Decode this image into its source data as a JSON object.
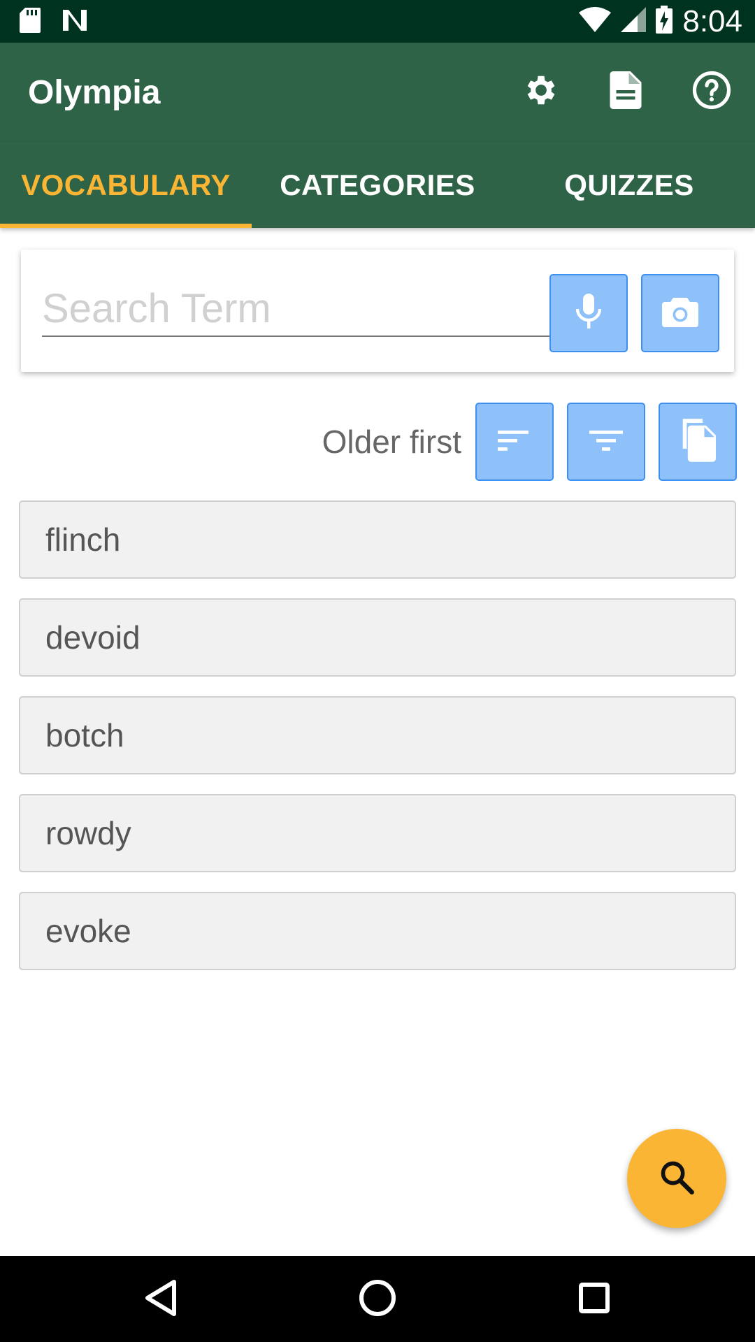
{
  "status_bar": {
    "time": "8:04",
    "icons": [
      "sd-card-icon",
      "n-notification-icon",
      "wifi-icon",
      "signal-icon",
      "battery-charging-icon"
    ]
  },
  "app_bar": {
    "title": "Olympia",
    "actions": [
      "settings-icon",
      "document-icon",
      "help-icon"
    ]
  },
  "tabs": [
    {
      "label": "VOCABULARY",
      "active": true
    },
    {
      "label": "CATEGORIES",
      "active": false
    },
    {
      "label": "QUIZZES",
      "active": false
    }
  ],
  "search": {
    "placeholder": "Search Term",
    "value": "",
    "buttons": [
      "mic-icon",
      "camera-icon"
    ]
  },
  "sort": {
    "label": "Older first",
    "buttons": [
      "sort-icon",
      "filter-icon",
      "copy-icon"
    ]
  },
  "vocabulary": [
    {
      "term": "flinch"
    },
    {
      "term": "devoid"
    },
    {
      "term": "botch"
    },
    {
      "term": "rowdy"
    },
    {
      "term": "evoke"
    }
  ],
  "fab": {
    "icon": "search-icon"
  },
  "nav_bar": {
    "buttons": [
      "back-icon",
      "home-icon",
      "recents-icon"
    ]
  },
  "colors": {
    "status_bar": "#00331f",
    "app_bar": "#2e6347",
    "accent": "#fbb534",
    "button_fill": "#8ec1fa",
    "button_border": "#3f8ff0",
    "list_item": "#f1f1f1"
  }
}
